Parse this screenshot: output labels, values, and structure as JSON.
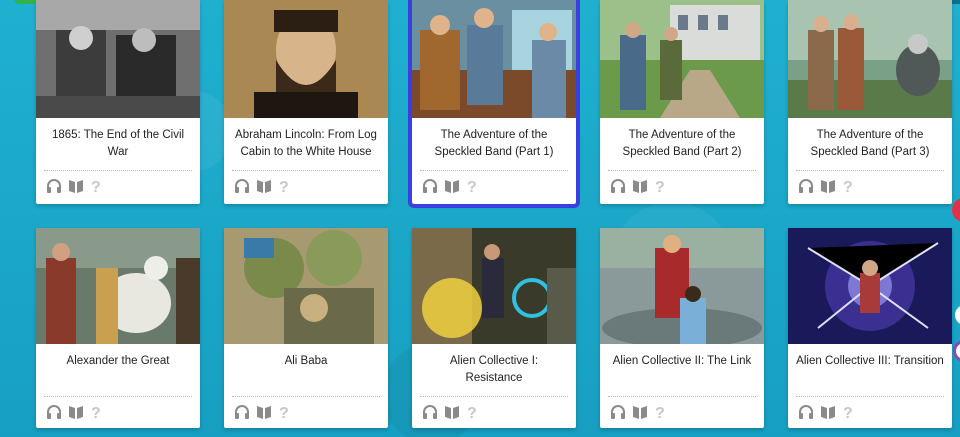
{
  "cards": [
    {
      "title": "1865: The End of the Civil War",
      "icons": [
        "headphones-icon",
        "book-icon",
        "quiz-icon"
      ]
    },
    {
      "title": "Abraham Lincoln: From Log Cabin to the White House",
      "icons": [
        "headphones-icon",
        "book-icon",
        "quiz-icon"
      ]
    },
    {
      "title": "The Adventure of the Speckled Band (Part 1)",
      "icons": [
        "headphones-icon",
        "book-icon",
        "quiz-icon"
      ]
    },
    {
      "title": "The Adventure of the Speckled Band (Part 2)",
      "icons": [
        "headphones-icon",
        "book-icon",
        "quiz-icon"
      ]
    },
    {
      "title": "The Adventure of the Speckled Band (Part 3)",
      "icons": [
        "headphones-icon",
        "book-icon",
        "quiz-icon"
      ]
    },
    {
      "title": "Alexander the Great",
      "icons": [
        "headphones-icon",
        "book-icon",
        "quiz-icon"
      ]
    },
    {
      "title": "Ali Baba",
      "icons": [
        "headphones-icon",
        "book-icon",
        "quiz-icon"
      ]
    },
    {
      "title": "Alien Collective I: Resistance",
      "icons": [
        "headphones-icon",
        "book-icon",
        "quiz-icon"
      ]
    },
    {
      "title": "Alien Collective II: The Link",
      "icons": [
        "headphones-icon",
        "book-icon",
        "quiz-icon"
      ]
    },
    {
      "title": "Alien Collective III: Transition",
      "icons": [
        "headphones-icon",
        "book-icon",
        "quiz-icon"
      ]
    }
  ],
  "colors": {
    "background": "#1aa7c8",
    "selected_outline": "#3a3fe0",
    "icon_color": "#8a8a8a",
    "quiz_icon_color": "#c8c8c8"
  }
}
